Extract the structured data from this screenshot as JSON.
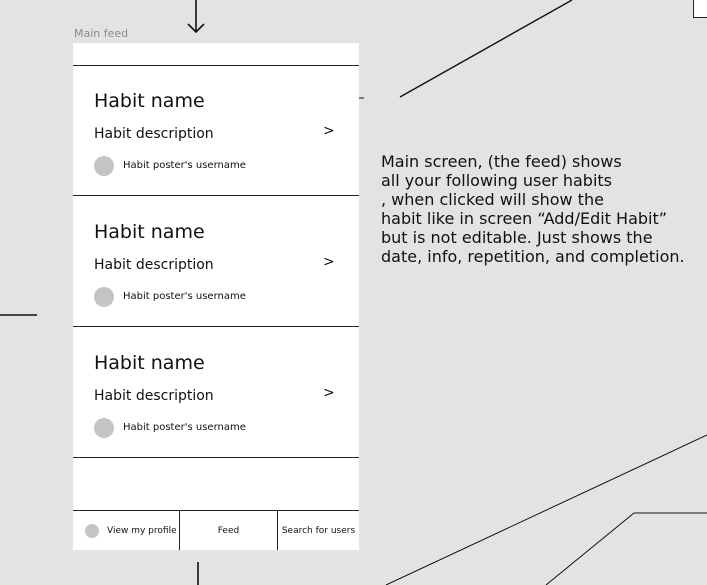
{
  "frame": {
    "label": "Main feed"
  },
  "feed": {
    "items": [
      {
        "title": "Habit name",
        "description": "Habit description",
        "chevron": ">",
        "username": "Habit poster's username"
      },
      {
        "title": "Habit name",
        "description": "Habit description",
        "chevron": ">",
        "username": "Habit poster's username"
      },
      {
        "title": "Habit name",
        "description": "Habit description",
        "chevron": ">",
        "username": "Habit poster's username"
      }
    ]
  },
  "nav": {
    "profile_label": "View my profile",
    "feed_label": "Feed",
    "search_label": "Search for users"
  },
  "annotation": {
    "text": "Main screen, (the feed) shows\nall your following user habits\n, when clicked will show the\nhabit like in screen “Add/Edit Habit”\nbut is not editable. Just shows the\ndate, info, repetition, and completion."
  },
  "colors": {
    "canvas_background": "#e3e3e3",
    "screen_background": "#ffffff",
    "placeholder_gray": "#c4c4c4",
    "line_color": "#111111"
  },
  "icons": {
    "arrow_down": "arrow-down-icon",
    "chevron_right": "chevron-right-icon",
    "avatar": "avatar-placeholder"
  }
}
